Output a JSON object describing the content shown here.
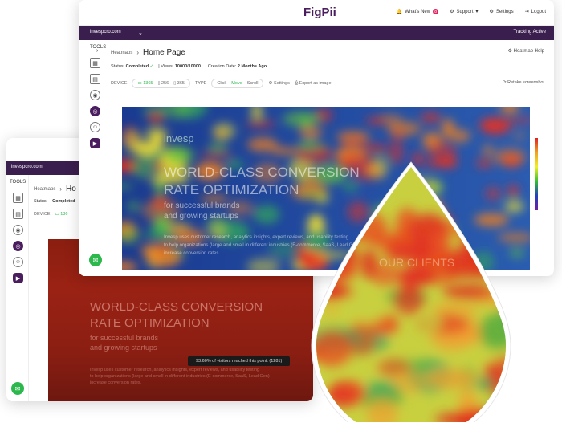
{
  "app": {
    "logo_text": "FigPii",
    "colors": {
      "brand": "#4a1e5e",
      "accent": "#2db84d"
    }
  },
  "topnav": {
    "whats_new": "What's New",
    "whats_new_count": "8",
    "support": "Support",
    "settings": "Settings",
    "logout": "Logout"
  },
  "account": {
    "domain": "invespcro.com",
    "tracking": "Tracking Active"
  },
  "sidebar": {
    "title": "TOOLS"
  },
  "breadcrumb": {
    "parent": "Heatmaps",
    "current": "Home Page",
    "current_partial": "Ho"
  },
  "help_label": "Heatmap Help",
  "status": {
    "status_label": "Status:",
    "status_value": "Completed",
    "views_label": "Views:",
    "views_value": "10000/10000",
    "created_label": "Creation Date:",
    "created_value": "2 Months Ago"
  },
  "controls": {
    "device_label": "DEVICE",
    "desktop": "1365",
    "tablet": "256",
    "mobile": "365",
    "type_label": "TYPE",
    "click": "Click",
    "move": "Move",
    "scroll": "Scroll",
    "settings": "Settings",
    "export": "Export as image",
    "retake": "Retake screenshot",
    "desktop_partial": "136"
  },
  "page": {
    "brand": "invesp",
    "headline_1": "WORLD-CLASS CONVERSION",
    "headline_2": "RATE OPTIMIZATION",
    "sub_1": "for successful brands",
    "sub_2": "and growing startups",
    "body_1": "Invesp uses customer research, analytics insights, expert reviews, and usability testing",
    "body_2": "to help organizations (large and small in different industries (E-commerce, SaaS, Lead Gen)",
    "body_3": "increase conversion rates.",
    "clients": "OUR CLIENTS"
  },
  "tooltip": "93.60% of visitors reached this point. (1281)"
}
